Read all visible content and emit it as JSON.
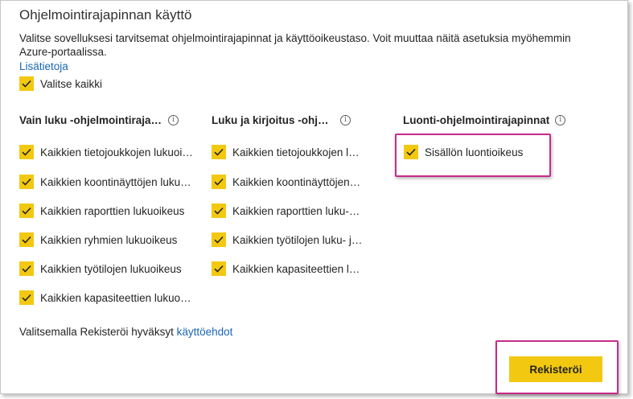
{
  "dialog": {
    "title": "Ohjelmointirajapinnan käyttö",
    "description": "Valitse sovelluksesi tarvitsemat ohjelmointirajapinnat ja käyttöoikeustaso. Voit muuttaa näitä asetuksia myöhemmin Azure-portaalissa.",
    "more_info_link": "Lisätietoja",
    "select_all_label": "Valitse kaikki"
  },
  "columns": [
    {
      "header": "Vain luku -ohjelmointirajapinnat",
      "items": [
        {
          "label": "Kaikkien tietojoukkojen lukuoikeus",
          "checked": true
        },
        {
          "label": "Kaikkien koontinäyttöjen lukuoikeus",
          "checked": true
        },
        {
          "label": "Kaikkien raporttien lukuoikeus",
          "checked": true
        },
        {
          "label": "Kaikkien ryhmien lukuoikeus",
          "checked": true
        },
        {
          "label": "Kaikkien työtilojen lukuoikeus",
          "checked": true
        },
        {
          "label": "Kaikkien kapasiteettien lukuoikeus",
          "checked": true
        }
      ]
    },
    {
      "header": "Luku ja kirjoitus -ohjelmointirajapinnat",
      "items": [
        {
          "label": "Kaikkien tietojoukkojen luku- ja kirjoitusoikeus",
          "checked": true
        },
        {
          "label": "Kaikkien koontinäyttöjen luku- ja kirjoitusoikeus",
          "checked": true
        },
        {
          "label": "Kaikkien raporttien luku- ja kirjoitusoikeus",
          "checked": true
        },
        {
          "label": "Kaikkien työtilojen luku- ja kirjoitusoikeus",
          "checked": true
        },
        {
          "label": "Kaikkien kapasiteettien luku- ja kirjoitusoikeus",
          "checked": true
        }
      ]
    },
    {
      "header": "Luonti-ohjelmointirajapinnat",
      "items": [
        {
          "label": "Sisällön luontioikeus",
          "checked": true
        }
      ]
    }
  ],
  "footer": {
    "terms_prefix": "Valitsemalla Rekisteröi hyväksyt ",
    "terms_link": "käyttöehdot",
    "register_label": "Rekisteröi"
  },
  "colors": {
    "accent_yellow": "#f2c811",
    "highlight_magenta": "#c72c8a",
    "link_blue": "#1967b3"
  },
  "icons": {
    "checkbox": "checkmark-icon",
    "info": "info-icon"
  }
}
